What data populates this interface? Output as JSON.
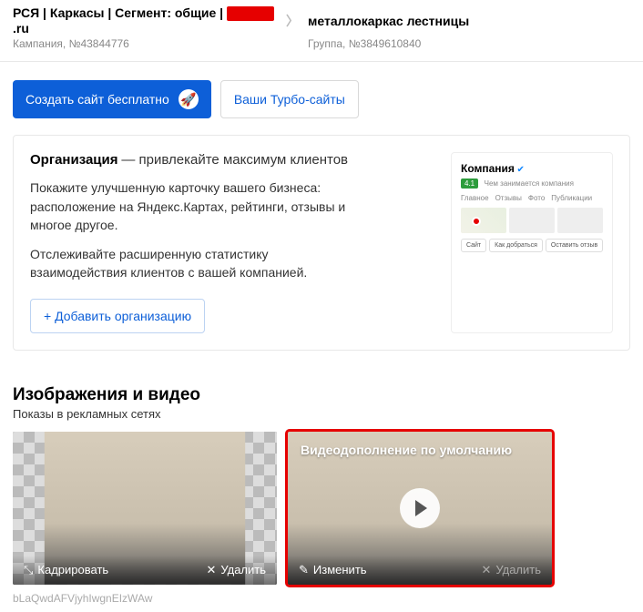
{
  "breadcrumb": {
    "campaign_title_prefix": "РСЯ | Каркасы | Сегмент: общие |",
    "campaign_title_suffix": ".ru",
    "campaign_sub": "Кампания, №43844776",
    "group_title": "металлокаркас лестницы",
    "group_sub": "Группа, №3849610840"
  },
  "actions": {
    "create_site": "Создать сайт бесплатно",
    "your_turbo": "Ваши Турбо-сайты"
  },
  "org_card": {
    "title": "Организация",
    "subtitle": "— привлекайте максимум клиентов",
    "p1": "Покажите улучшенную карточку вашего бизнеса: расположение на Яндекс.Картах, рейтинги, отзывы и многое другое.",
    "p2": "Отслеживайте расширенную статистику взаимодействия клиентов с вашей компанией.",
    "add_btn": "+   Добавить организацию",
    "preview": {
      "name": "Компания",
      "rating": "4.1",
      "desc": "Чем занимается компания",
      "tabs": [
        "Главное",
        "Отзывы",
        "Фото",
        "Публикации"
      ],
      "btns": [
        "Сайт",
        "Как добраться",
        "Оставить отзыв"
      ]
    }
  },
  "media": {
    "heading": "Изображения и видео",
    "sub": "Показы в рекламных сетях",
    "image": {
      "crop": "Кадрировать",
      "delete": "Удалить",
      "hash": "bLaQwdAFVjyhIwgnEIzWAw"
    },
    "video": {
      "label": "Видеодополнение по умолчанию",
      "edit": "Изменить",
      "delete": "Удалить"
    }
  }
}
